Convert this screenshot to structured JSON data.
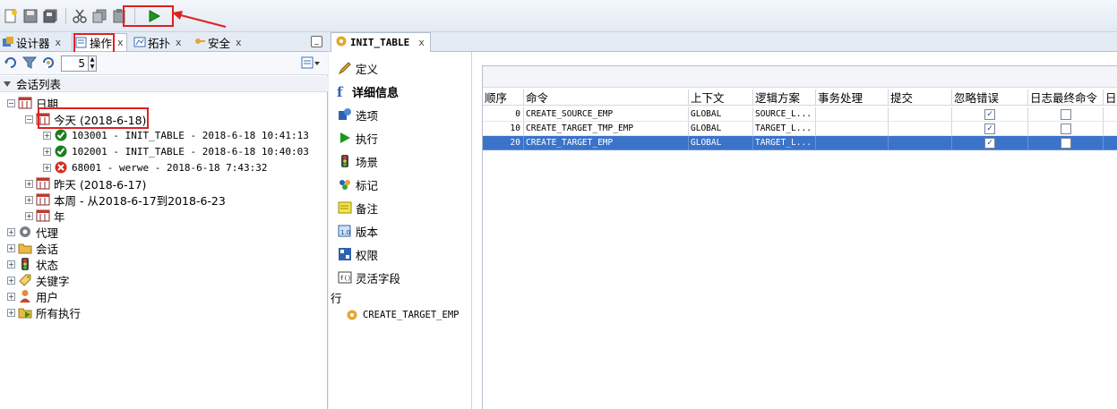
{
  "left_tabs": [
    {
      "label": "设计器",
      "close": "x"
    },
    {
      "label": "操作",
      "close": "x"
    },
    {
      "label": "拓扑",
      "close": "x"
    },
    {
      "label": "安全",
      "close": "x"
    }
  ],
  "spinner_value": "5",
  "section_title": "会话列表",
  "tree": {
    "date": "日期",
    "today": "今天 (2018-6-18)",
    "sessions": [
      "103001 - INIT_TABLE - 2018-6-18 10:41:13",
      "102001 - INIT_TABLE - 2018-6-18 10:40:03",
      "68001 - werwe  - 2018-6-18 7:43:32"
    ],
    "yesterday": "昨天 (2018-6-17)",
    "this_week": "本周 - 从2018-6-17到2018-6-23",
    "year": "年",
    "roots": [
      "代理",
      "会话",
      "状态",
      "关键字",
      "用户",
      "所有执行"
    ]
  },
  "editor_tab": {
    "label": "INIT_TABLE",
    "close": "x"
  },
  "nav": {
    "items": [
      "定义",
      "详细信息",
      "选项",
      "执行",
      "场景",
      "标记",
      "备注",
      "版本",
      "权限",
      "灵活字段"
    ],
    "row_label": "行",
    "row_item": "CREATE_TARGET_EMP"
  },
  "grid": {
    "columns": [
      "顺序",
      "命令",
      "上下文",
      "逻辑方案",
      "事务处理",
      "提交",
      "忽略错误",
      "日志最终命令",
      "日志"
    ],
    "rows": [
      {
        "seq": "0",
        "cmd": "CREATE_SOURCE_EMP",
        "ctx": "GLOBAL",
        "schema": "SOURCE_L...",
        "tx": "",
        "commit": "",
        "ignore": "✓",
        "logfinal": ""
      },
      {
        "seq": "10",
        "cmd": "CREATE_TARGET_TMP_EMP",
        "ctx": "GLOBAL",
        "schema": "TARGET_L...",
        "tx": "",
        "commit": "",
        "ignore": "✓",
        "logfinal": ""
      },
      {
        "seq": "20",
        "cmd": "CREATE_TARGET_EMP",
        "ctx": "GLOBAL",
        "schema": "TARGET_L...",
        "tx": "",
        "commit": "",
        "ignore": "✓",
        "logfinal": ""
      }
    ]
  },
  "colors": {
    "selected_row": "#3a73c9",
    "highlight": "#e02020",
    "run_green": "#1a9a1a"
  }
}
